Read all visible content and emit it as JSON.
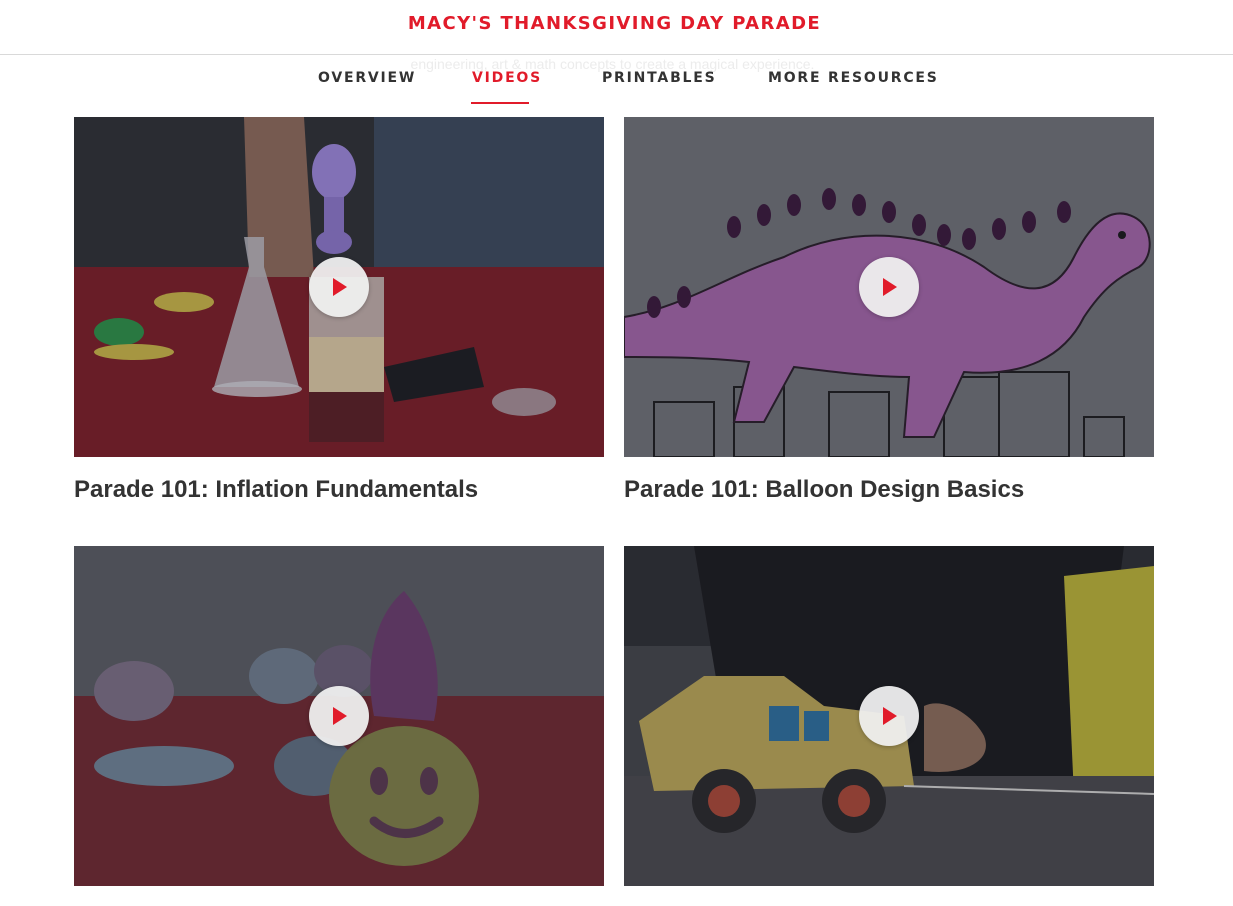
{
  "header": {
    "brand": "MACY'S THANKSGIVING DAY PARADE"
  },
  "intro_text": "engineering, art & math concepts to create a magical experience.",
  "tabs": [
    {
      "label": "OVERVIEW",
      "active": false
    },
    {
      "label": "VIDEOS",
      "active": true
    },
    {
      "label": "PRINTABLES",
      "active": false
    },
    {
      "label": "MORE RESOURCES",
      "active": false
    }
  ],
  "videos": [
    {
      "title": "Parade 101: Inflation Fundamentals",
      "play_icon": "play-icon"
    },
    {
      "title": "Parade 101: Balloon Design Basics",
      "play_icon": "play-icon"
    },
    {
      "title": "",
      "play_icon": "play-icon"
    },
    {
      "title": "",
      "play_icon": "play-icon"
    }
  ],
  "colors": {
    "accent": "#e11b2a",
    "text": "#333333",
    "divider": "#d9d9d9"
  }
}
